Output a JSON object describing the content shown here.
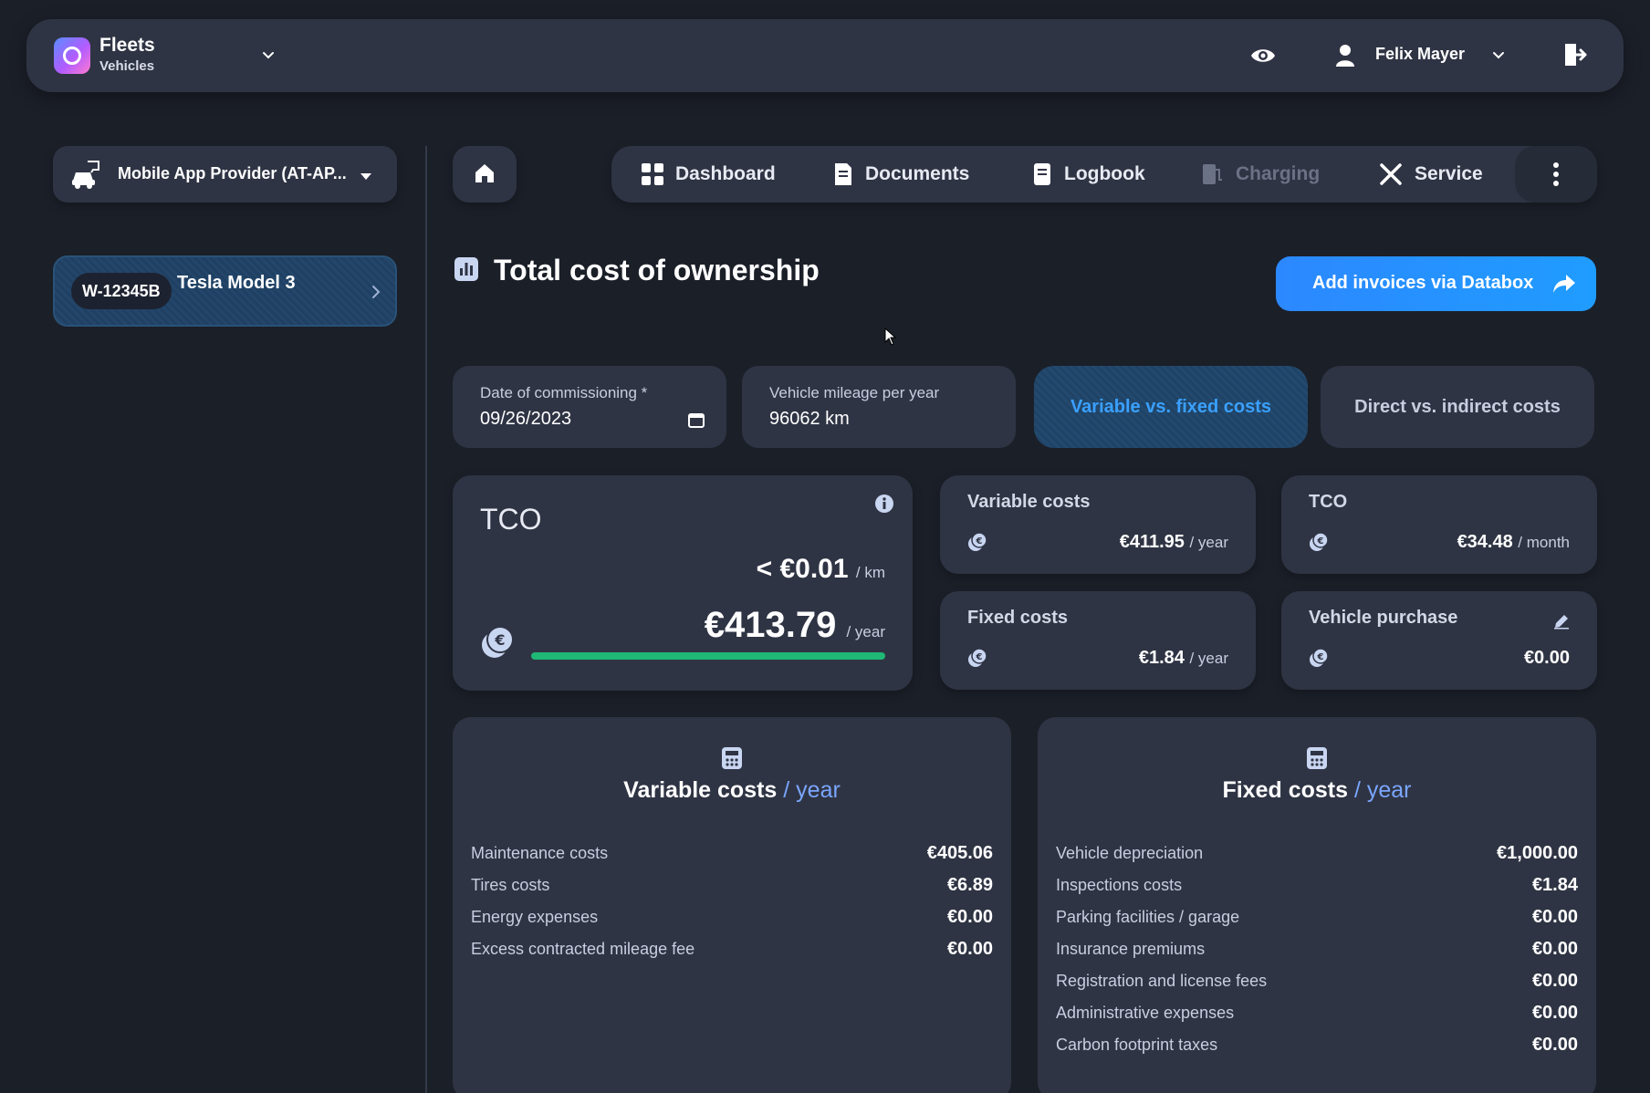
{
  "app": {
    "title": "Fleets",
    "subtitle": "Vehicles"
  },
  "user": {
    "name": "Felix Mayer"
  },
  "sidebar": {
    "provider": "Mobile App Provider (AT-AP...",
    "vehicle": {
      "plate": "W-12345B",
      "model": "Tesla Model 3"
    }
  },
  "nav": {
    "items": [
      {
        "label": "Dashboard",
        "icon": "dashboard-icon"
      },
      {
        "label": "Documents",
        "icon": "documents-icon"
      },
      {
        "label": "Logbook",
        "icon": "logbook-icon"
      },
      {
        "label": "Charging",
        "icon": "charging-icon",
        "disabled": true
      },
      {
        "label": "Service",
        "icon": "service-icon"
      }
    ]
  },
  "page": {
    "title": "Total cost of ownership"
  },
  "databox_button": {
    "label": "Add invoices via Databox"
  },
  "filters": {
    "commissioning": {
      "label": "Date of commissioning *",
      "value": "09/26/2023"
    },
    "mileage": {
      "label": "Vehicle mileage per year",
      "value": "96062 km"
    },
    "segments": [
      "Variable vs. fixed costs",
      "Direct vs. indirect costs"
    ],
    "active_segment": "Variable vs. fixed costs"
  },
  "tco_card": {
    "title": "TCO",
    "per_km": "< €0.01",
    "per_km_unit": "/ km",
    "per_year": "€413.79",
    "per_year_unit": "/ year",
    "progress_percent": 100,
    "progress_color": "#1fb874"
  },
  "summary_cards": {
    "variable": {
      "title": "Variable costs",
      "value": "€411.95",
      "unit": "/ year"
    },
    "tco_month": {
      "title": "TCO",
      "value": "€34.48",
      "unit": "/ month"
    },
    "fixed": {
      "title": "Fixed costs",
      "value": "€1.84",
      "unit": "/ year"
    },
    "purchase": {
      "title": "Vehicle purchase",
      "value": "€0.00"
    }
  },
  "variable_costs": {
    "title": "Variable costs",
    "title_suffix": "/ year",
    "rows": [
      {
        "label": "Maintenance costs",
        "value": "€405.06"
      },
      {
        "label": "Tires costs",
        "value": "€6.89"
      },
      {
        "label": "Energy expenses",
        "value": "€0.00"
      },
      {
        "label": "Excess contracted mileage fee",
        "value": "€0.00"
      }
    ]
  },
  "fixed_costs": {
    "title": "Fixed costs",
    "title_suffix": "/ year",
    "rows": [
      {
        "label": "Vehicle depreciation",
        "value": "€1,000.00"
      },
      {
        "label": "Inspections costs",
        "value": "€1.84"
      },
      {
        "label": "Parking facilities / garage",
        "value": "€0.00"
      },
      {
        "label": "Insurance premiums",
        "value": "€0.00"
      },
      {
        "label": "Registration and license fees",
        "value": "€0.00"
      },
      {
        "label": "Administrative expenses",
        "value": "€0.00"
      },
      {
        "label": "Carbon footprint taxes",
        "value": "€0.00"
      }
    ]
  },
  "colors": {
    "accent": "#2c88ff",
    "background": "#1b1f28",
    "card": "#2f3444",
    "success": "#1fb874"
  }
}
